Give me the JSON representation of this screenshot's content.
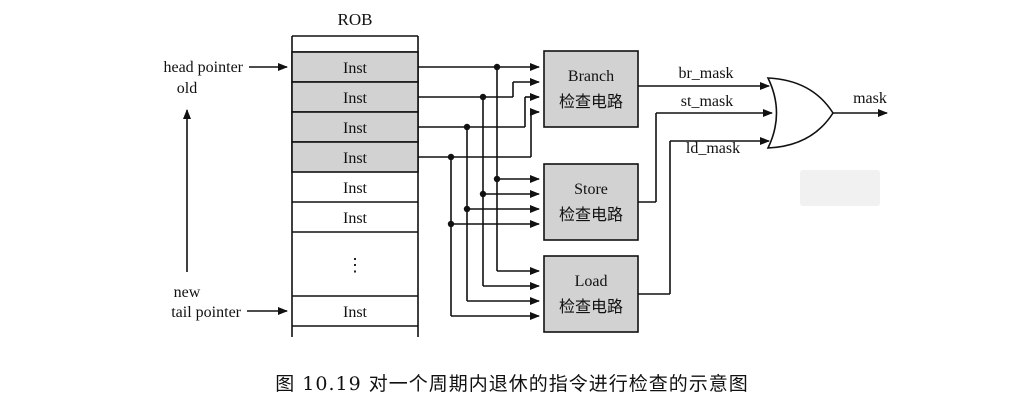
{
  "rob": {
    "title": "ROB",
    "entries": [
      "Inst",
      "Inst",
      "Inst",
      "Inst",
      "Inst",
      "Inst",
      "⋮",
      "Inst"
    ],
    "highlighted_count": 4
  },
  "pointers": {
    "head_line1": "head pointer",
    "head_line2": "old",
    "tail_line1": "new",
    "tail_line2": "tail pointer"
  },
  "checkers": {
    "branch": {
      "line1": "Branch",
      "line2": "检查电路"
    },
    "store": {
      "line1": "Store",
      "line2": "检查电路"
    },
    "load": {
      "line1": "Load",
      "line2": "检查电路"
    }
  },
  "signals": {
    "br_mask": "br_mask",
    "st_mask": "st_mask",
    "ld_mask": "ld_mask",
    "out": "mask"
  },
  "caption": "图 10.19   对一个周期内退休的指令进行检查的示意图",
  "colors": {
    "highlight": "#d2d2d2",
    "line": "#111111"
  }
}
